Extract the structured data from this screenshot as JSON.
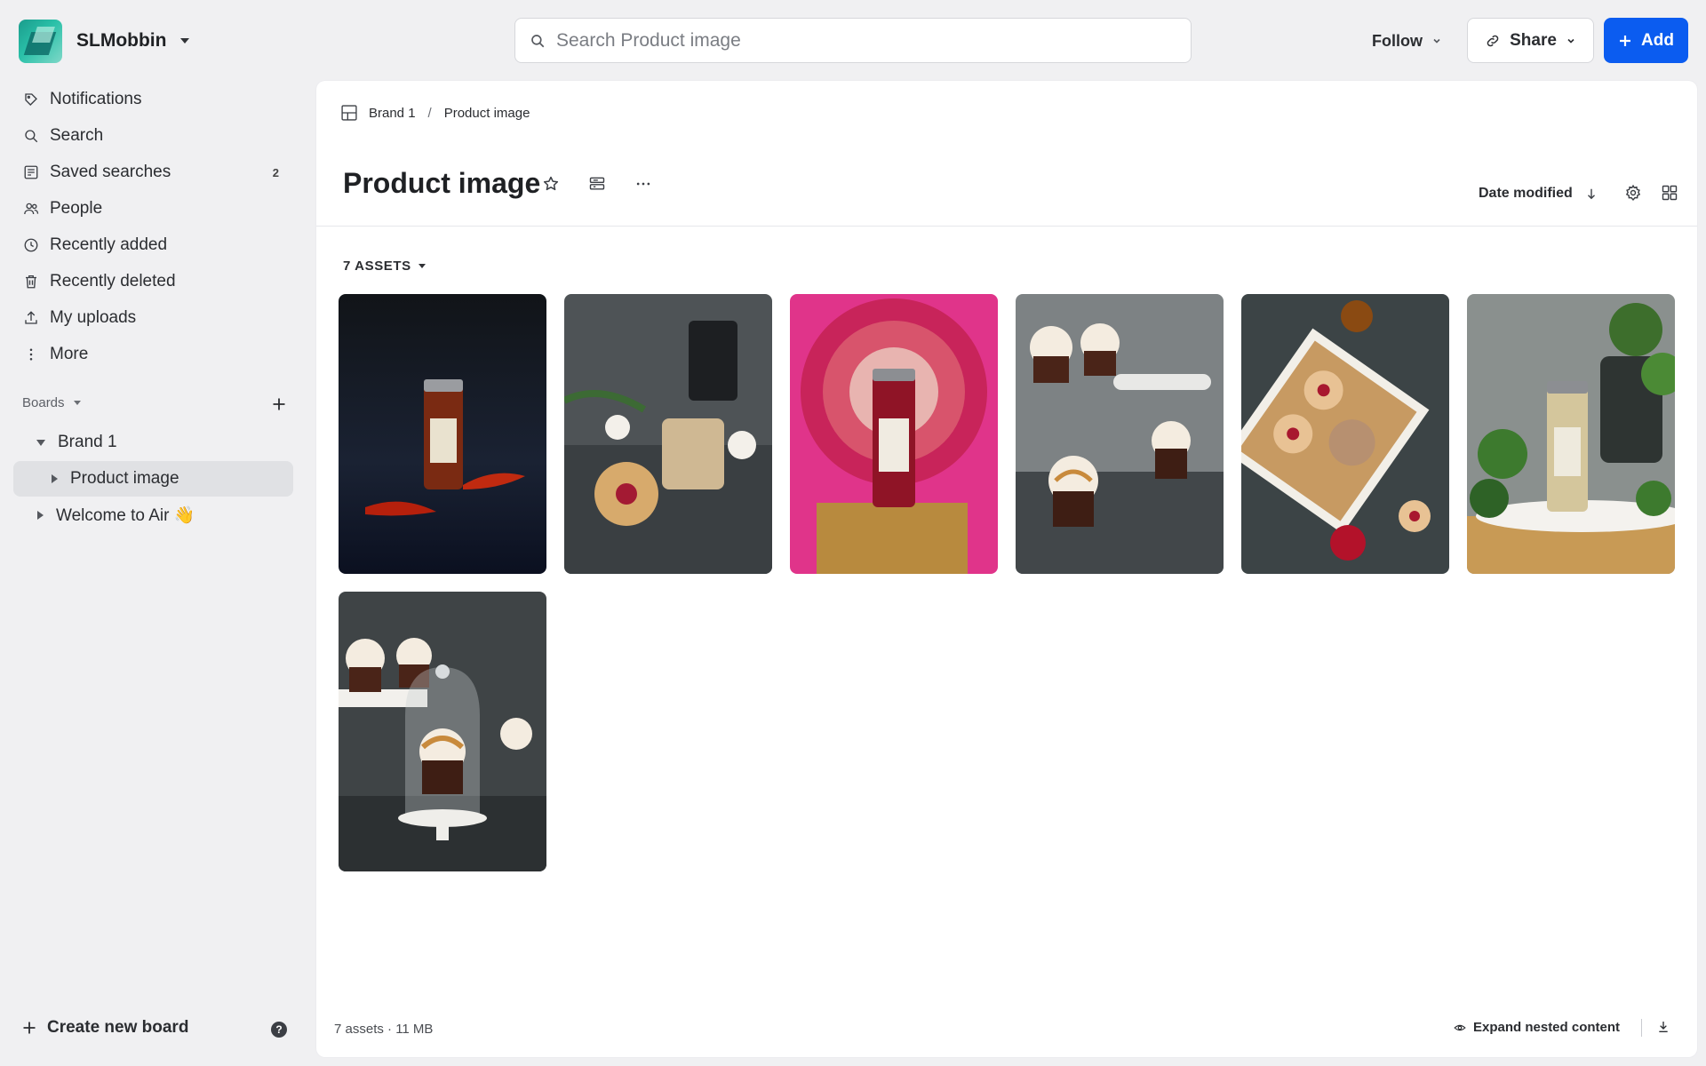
{
  "workspace": {
    "name": "SLMobbin"
  },
  "search": {
    "placeholder": "Search Product image"
  },
  "header": {
    "follow_label": "Follow",
    "share_label": "Share",
    "add_label": "Add"
  },
  "sidebar": {
    "items": [
      {
        "label": "Notifications",
        "icon": "notification-icon"
      },
      {
        "label": "Search",
        "icon": "search-icon"
      },
      {
        "label": "Saved searches",
        "icon": "saved-searches-icon",
        "count": "2"
      },
      {
        "label": "People",
        "icon": "people-icon"
      },
      {
        "label": "Recently added",
        "icon": "clock-icon"
      },
      {
        "label": "Recently deleted",
        "icon": "trash-icon"
      },
      {
        "label": "My uploads",
        "icon": "upload-icon"
      },
      {
        "label": "More",
        "icon": "more-vertical-icon"
      }
    ],
    "boards_label": "Boards",
    "boards": [
      {
        "label": "Brand 1",
        "expanded": true
      },
      {
        "label": "Product image",
        "selected": true
      },
      {
        "label": "Welcome to Air 👋"
      }
    ],
    "create_board_label": "Create new board",
    "help_label": "?"
  },
  "main": {
    "breadcrumb": {
      "parent": "Brand 1",
      "separator": "/",
      "current": "Product image"
    },
    "title": "Product image",
    "sort_label": "Date modified",
    "assets_count_label": "7 ASSETS",
    "assets": [
      {
        "name": "chili-spice-jar",
        "bg": [
          "#1b2233",
          "#0d1220"
        ],
        "accent": "#b23a1a"
      },
      {
        "name": "linzer-cookies-jar",
        "bg": [
          "#6e7275",
          "#3a3e40"
        ],
        "accent": "#c7a574"
      },
      {
        "name": "pink-spice-jar",
        "bg": [
          "#e03a8a",
          "#c8145e"
        ],
        "accent": "#8f1c2c"
      },
      {
        "name": "caramel-cupcakes",
        "bg": [
          "#9da2a4",
          "#55595b"
        ],
        "accent": "#e9d9c2"
      },
      {
        "name": "cookie-gift-box",
        "bg": [
          "#4c5456",
          "#2a3032"
        ],
        "accent": "#e8c899"
      },
      {
        "name": "herb-spice-jar",
        "bg": [
          "#8f9694",
          "#5e6662"
        ],
        "accent": "#d6c8a0"
      },
      {
        "name": "cupcake-under-glass",
        "bg": [
          "#4c5254",
          "#262a2c"
        ],
        "accent": "#e8d8bd"
      }
    ],
    "footer": {
      "summary": "7 assets · 11 MB",
      "expand_label": "Expand nested content"
    }
  },
  "colors": {
    "accent": "#0b5cf0",
    "sidebar_bg": "#f0f0f2",
    "selected_bg": "#e0e1e4"
  }
}
